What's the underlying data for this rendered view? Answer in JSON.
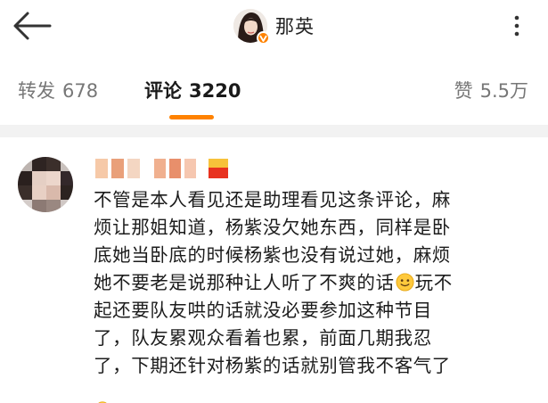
{
  "header": {
    "back_icon": "arrow-left-icon",
    "profile_name": "那英",
    "verified_badge_color": "#ff8200",
    "more_icon": "more-vertical-icon"
  },
  "tabs": {
    "repost": {
      "label": "转发",
      "count": "678"
    },
    "comments": {
      "label": "评论",
      "count": "3220",
      "active": true
    },
    "likes": {
      "label": "赞",
      "count": "5.5万"
    },
    "accent_color": "#ff8200"
  },
  "comment": {
    "author_name_obscured": true,
    "lines": [
      "不管是本人看见还是助理看见这条评论，麻",
      "烦让那姐知道，杨紫没欠她东西，同样是卧",
      "底她当卧底的时候杨紫也没有说过她，麻烦",
      "她不要老是说那种让人听了不爽的话",
      "玩不",
      "起还要队友哄的话就没必要参加这种节目",
      "了，队友累观众看着也累，前面几期我忍",
      "了，下期还针对杨紫的话就别管我不客气了"
    ],
    "inline_emoji": "smile-emoji-icon"
  }
}
